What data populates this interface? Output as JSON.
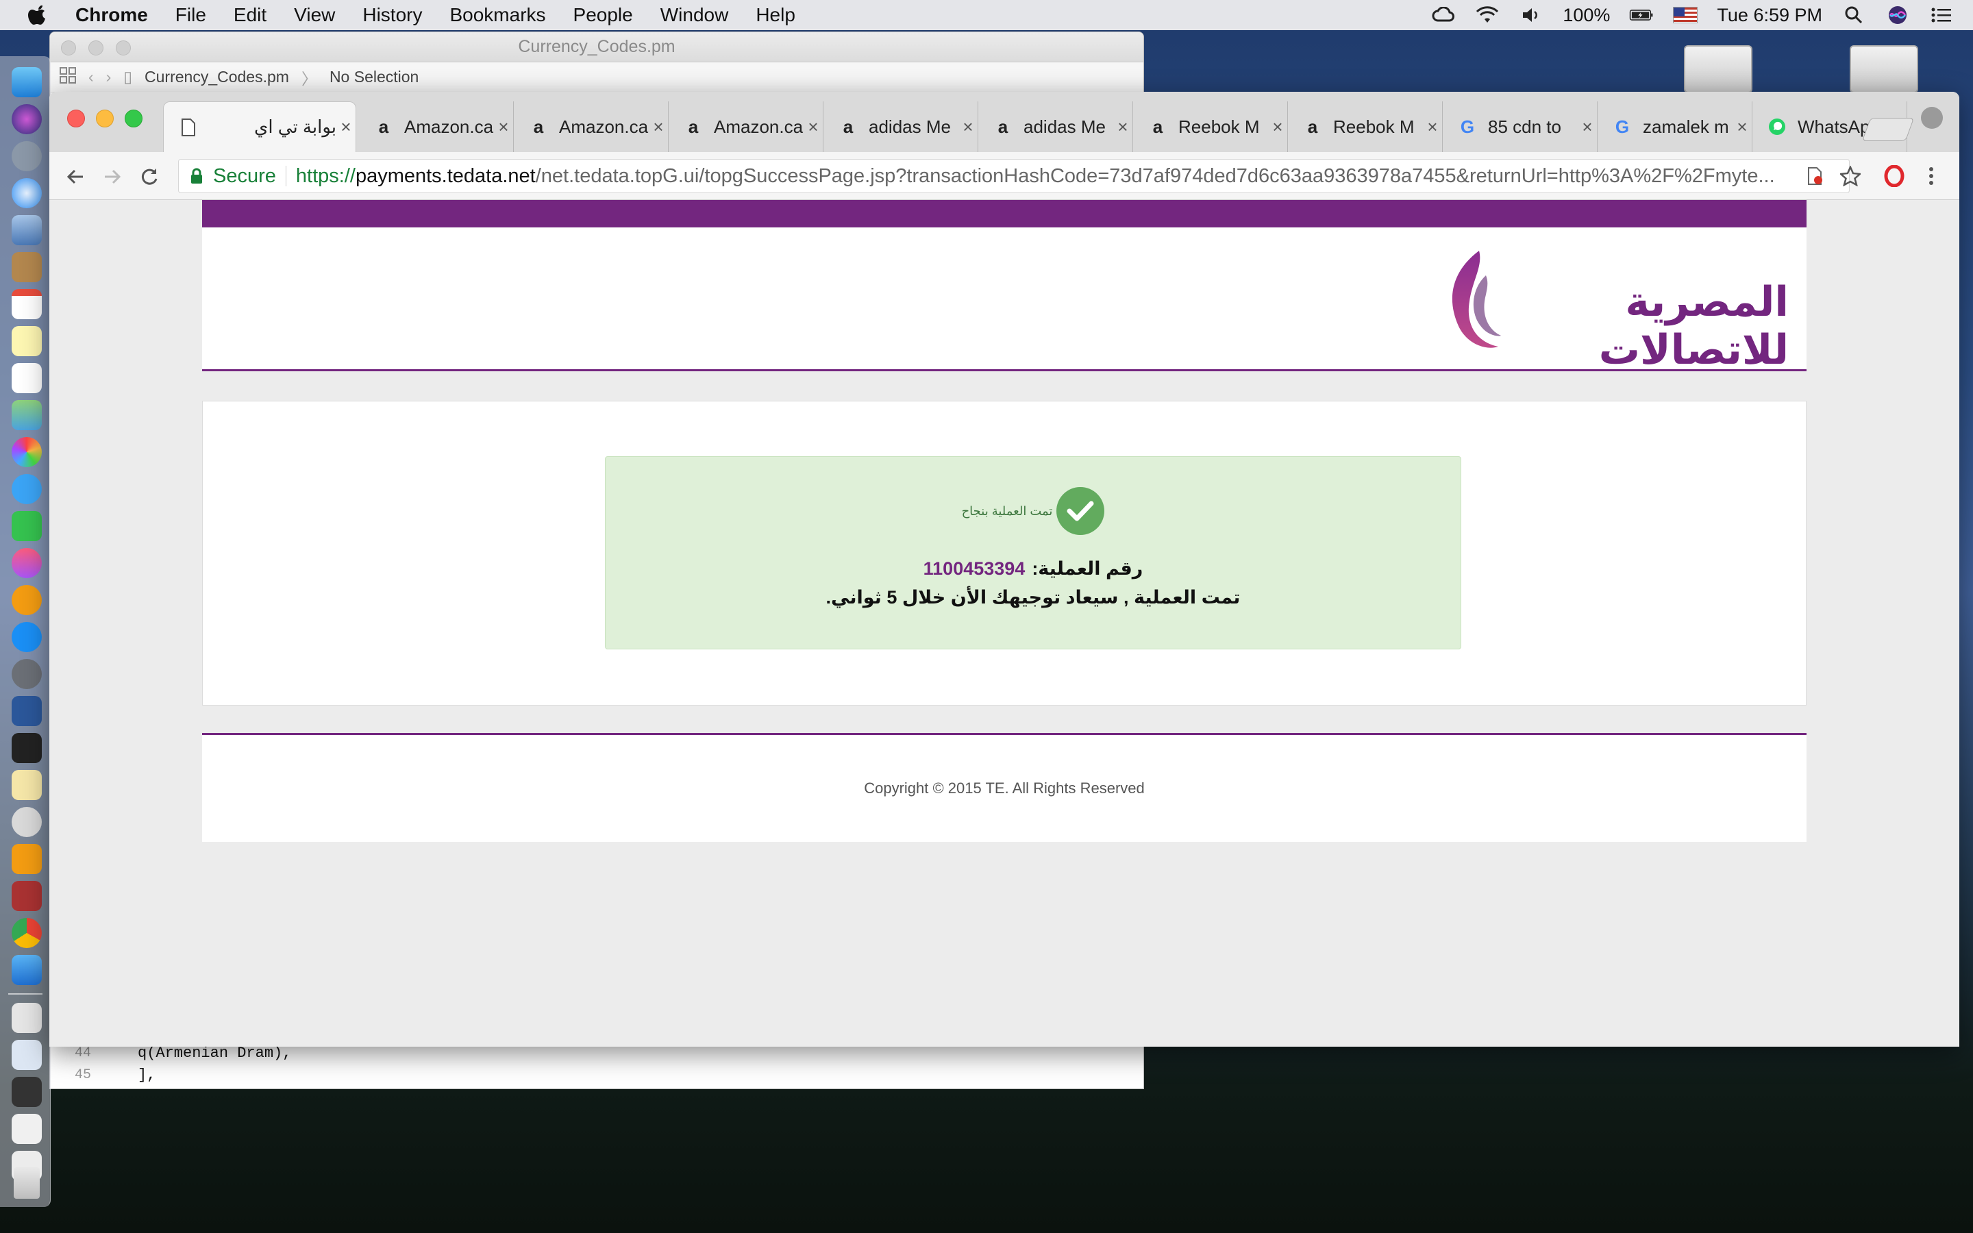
{
  "menubar": {
    "app": "Chrome",
    "items": [
      "File",
      "Edit",
      "View",
      "History",
      "Bookmarks",
      "People",
      "Window",
      "Help"
    ],
    "battery": "100%",
    "clock": "Tue 6:59 PM"
  },
  "editor": {
    "title": "Currency_Codes.pm",
    "path_file": "Currency_Codes.pm",
    "path_selection": "No Selection",
    "lines": [
      {
        "num": "44",
        "code": "q(Armenian Dram),"
      },
      {
        "num": "45",
        "code": "],"
      }
    ]
  },
  "browser": {
    "tabs": [
      {
        "title": "بوابة تي اي",
        "icon": "page-icon",
        "active": true
      },
      {
        "title": "Amazon.ca",
        "icon": "amazon-icon"
      },
      {
        "title": "Amazon.ca",
        "icon": "amazon-icon"
      },
      {
        "title": "Amazon.ca",
        "icon": "amazon-icon"
      },
      {
        "title": "adidas Me",
        "icon": "amazon-icon"
      },
      {
        "title": "adidas Me",
        "icon": "amazon-icon"
      },
      {
        "title": "Reebok M",
        "icon": "amazon-icon"
      },
      {
        "title": "Reebok M",
        "icon": "amazon-icon"
      },
      {
        "title": "85 cdn to",
        "icon": "google-icon"
      },
      {
        "title": "zamalek m",
        "icon": "google-icon"
      },
      {
        "title": "WhatsApp",
        "icon": "whatsapp-icon"
      }
    ],
    "secure_label": "Secure",
    "url_scheme": "https://",
    "url_host": "payments.tedata.net",
    "url_path": "/net.tedata.topG.ui/topgSuccessPage.jsp?transactionHashCode=73d7af974ded7d6c63aa9363978a7455&returnUrl=http%3A%2F%2Fmyte..."
  },
  "page": {
    "logo_text": "المصرية للاتصالات",
    "success_message": "تمت العملية بنجاح",
    "transaction_label": "رقم العملية:",
    "transaction_number": "1100453394",
    "redirect_message": "تمت العملية , سيعاد توجيهك الأن خلال 5 ثواني.",
    "copyright": "Copyright © 2015 TE. All Rights Reserved"
  },
  "colors": {
    "brand_purple": "#73267f",
    "success_bg": "#dff0d8",
    "success_check": "#62ab5e"
  }
}
